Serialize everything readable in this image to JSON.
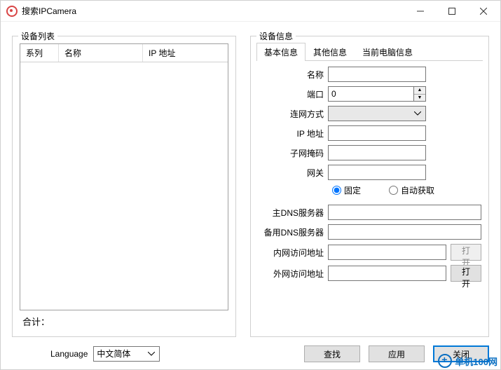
{
  "window": {
    "title": "搜索IPCamera"
  },
  "deviceList": {
    "legend": "设备列表",
    "columns": {
      "series": "系列",
      "name": "名称",
      "ip": "IP 地址"
    },
    "totalLabel": "合计："
  },
  "deviceInfo": {
    "legend": "设备信息",
    "tabs": {
      "basic": "基本信息",
      "other": "其他信息",
      "pc": "当前电脑信息"
    },
    "fields": {
      "name": "名称",
      "port": "端口",
      "portValue": "0",
      "connType": "连网方式",
      "ip": "IP 地址",
      "subnet": "子网掩码",
      "gateway": "网关",
      "fixed": "固定",
      "auto": "自动获取",
      "primaryDns": "主DNS服务器",
      "backupDns": "备用DNS服务器",
      "internalUrl": "内网访问地址",
      "externalUrl": "外网访问地址",
      "open": "打开"
    }
  },
  "bottom": {
    "languageLabel": "Language",
    "languageValue": "中文简体",
    "search": "查找",
    "apply": "应用",
    "close": "关闭"
  },
  "watermark": "单机100网"
}
